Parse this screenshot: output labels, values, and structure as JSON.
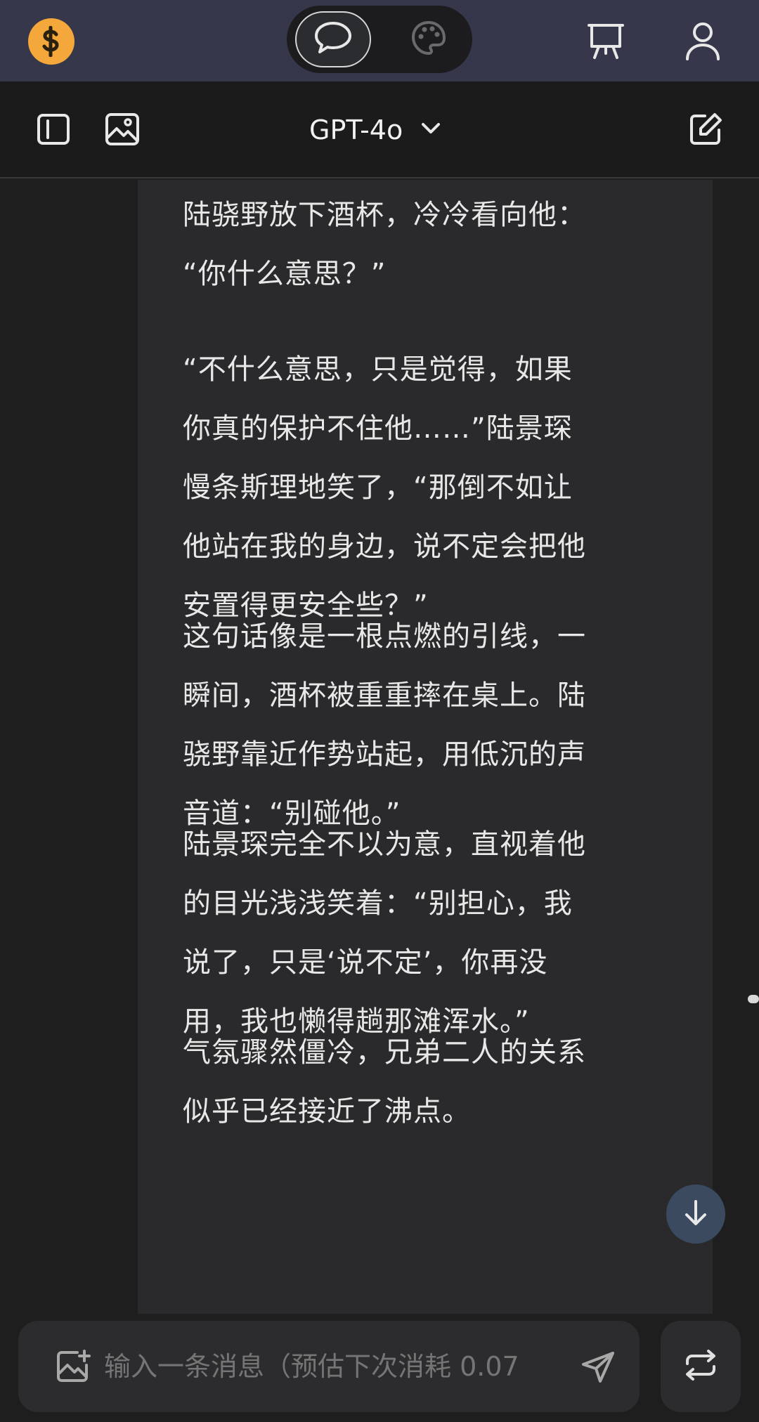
{
  "topbar": {
    "coin_icon": "dollar-coin-icon",
    "modes": [
      {
        "name": "chat",
        "icon": "chat-bubble-icon",
        "active": true
      },
      {
        "name": "image",
        "icon": "palette-icon",
        "active": false
      }
    ],
    "right_icons": [
      "presentation-board-icon",
      "user-icon"
    ],
    "colors": {
      "bar": "#36374a",
      "coin": "#f4a73a"
    }
  },
  "header": {
    "model": "GPT-4o",
    "left_icons": [
      "sidebar-icon",
      "image-icon"
    ],
    "right_icon": "new-chat-icon"
  },
  "messages": {
    "paragraphs": [
      "陆骁野放下酒杯，冷冷看向他：\n“你什么意思？”",
      "“不什么意思，只是觉得，如果\n你真的保护不住他……”陆景琛\n慢条斯理地笑了，“那倒不如让\n他站在我的身边，说不定会把他\n安置得更安全些？”",
      "这句话像是一根点燃的引线，一\n瞬间，酒杯被重重摔在桌上。陆\n骁野靠近作势站起，用低沉的声\n音道：“别碰他。”",
      "陆景琛完全不以为意，直视着他\n的目光浅浅笑着：“别担心，我\n说了，只是‘说不定’，你再没\n用，我也懒得趟那滩浑水。”",
      "气氛骤然僵冷，兄弟二人的关系\n似乎已经接近了沸点。"
    ]
  },
  "composer": {
    "placeholder": "输入一条消息（预估下次消耗 0.07",
    "icons": [
      "add-image-icon",
      "send-icon",
      "regenerate-icon",
      "arrow-down-icon"
    ]
  }
}
